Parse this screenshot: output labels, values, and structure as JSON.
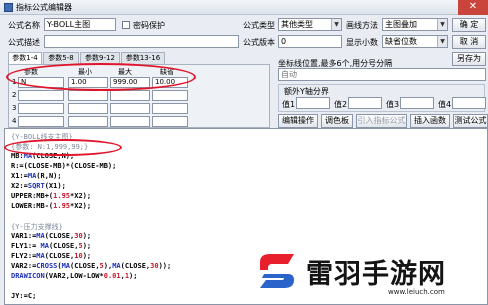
{
  "window": {
    "title": "指标公式编辑器",
    "close_glyph": "✕"
  },
  "form": {
    "name_label": "公式名称",
    "name_value": "Y-BOLL主图",
    "password_label": "密码保护",
    "desc_label": "公式描述",
    "desc_value": "",
    "type_label": "公式类型",
    "type_value": "其他类型",
    "draw_label": "画线方法",
    "draw_value": "主图叠加",
    "version_label": "公式版本",
    "version_value": "0",
    "decimals_label": "显示小数",
    "decimals_value": "缺省位数"
  },
  "buttons": {
    "ok": "确 定",
    "cancel": "取 消",
    "save_as": "另存为",
    "edit_ops": "编辑操作",
    "palette": "调色板",
    "import_formula": "引入指标公式",
    "insert_func": "插入函数",
    "test_formula": "测试公式"
  },
  "tabs": [
    "参数1-4",
    "参数5-8",
    "参数9-12",
    "参数13-16"
  ],
  "params": {
    "headers": [
      "参数",
      "最小",
      "最大",
      "缺省"
    ],
    "rows": [
      {
        "num": "1",
        "name": "N",
        "min": "1.00",
        "max": "999.00",
        "default": "10.00"
      },
      {
        "num": "2",
        "name": "",
        "min": "",
        "max": "",
        "default": ""
      },
      {
        "num": "3",
        "name": "",
        "min": "",
        "max": "",
        "default": ""
      },
      {
        "num": "4",
        "name": "",
        "min": "",
        "max": "",
        "default": ""
      }
    ]
  },
  "axis_hint": {
    "label": "坐标线位置,最多6个,用分号分隔",
    "value": "自动",
    "group_label": "额外Y轴分界",
    "v1": "值1",
    "v2": "值2",
    "v3": "值3",
    "v4": "值4"
  },
  "code_lines": [
    {
      "text": "{Y-BOLL线支主图}",
      "kind": "comment"
    },
    {
      "text": "{参数: N:1,999,99;}",
      "kind": "comment"
    },
    {
      "text": "MB:MA(CLOSE,N);",
      "kind": "code"
    },
    {
      "text": "R:=(CLOSE-MB)*(CLOSE-MB);",
      "kind": "code"
    },
    {
      "text": "X1:=MA(R,N);",
      "kind": "code"
    },
    {
      "text": "X2:=SQRT(X1);",
      "kind": "code"
    },
    {
      "text": "UPPER:MB+(1.95*X2);",
      "kind": "code"
    },
    {
      "text": "LOWER:MB-(1.95*X2);",
      "kind": "code"
    },
    {
      "text": "",
      "kind": "code"
    },
    {
      "text": "{Y-压力支撑线}",
      "kind": "comment"
    },
    {
      "text": "VAR1:=MA(CLOSE,30);",
      "kind": "code"
    },
    {
      "text": "FLY1:= MA(CLOSE,5);",
      "kind": "code"
    },
    {
      "text": "FLY2:=MA(CLOSE,10);",
      "kind": "code"
    },
    {
      "text": "VAR2:=CROSS(MA(CLOSE,5),MA(CLOSE,30));",
      "kind": "code"
    },
    {
      "text": "DRAWICON(VAR2,LOW-LOW*0.01,1);",
      "kind": "code"
    },
    {
      "text": "",
      "kind": "code"
    },
    {
      "text": "JY:=C;",
      "kind": "code"
    }
  ],
  "watermark": {
    "brand": "雷羽手游网",
    "url": "www.leiuch.com"
  },
  "colors": {
    "annotation_red": "#e0152b",
    "titlebar": "#dde3ec",
    "close": "#c9453c"
  }
}
